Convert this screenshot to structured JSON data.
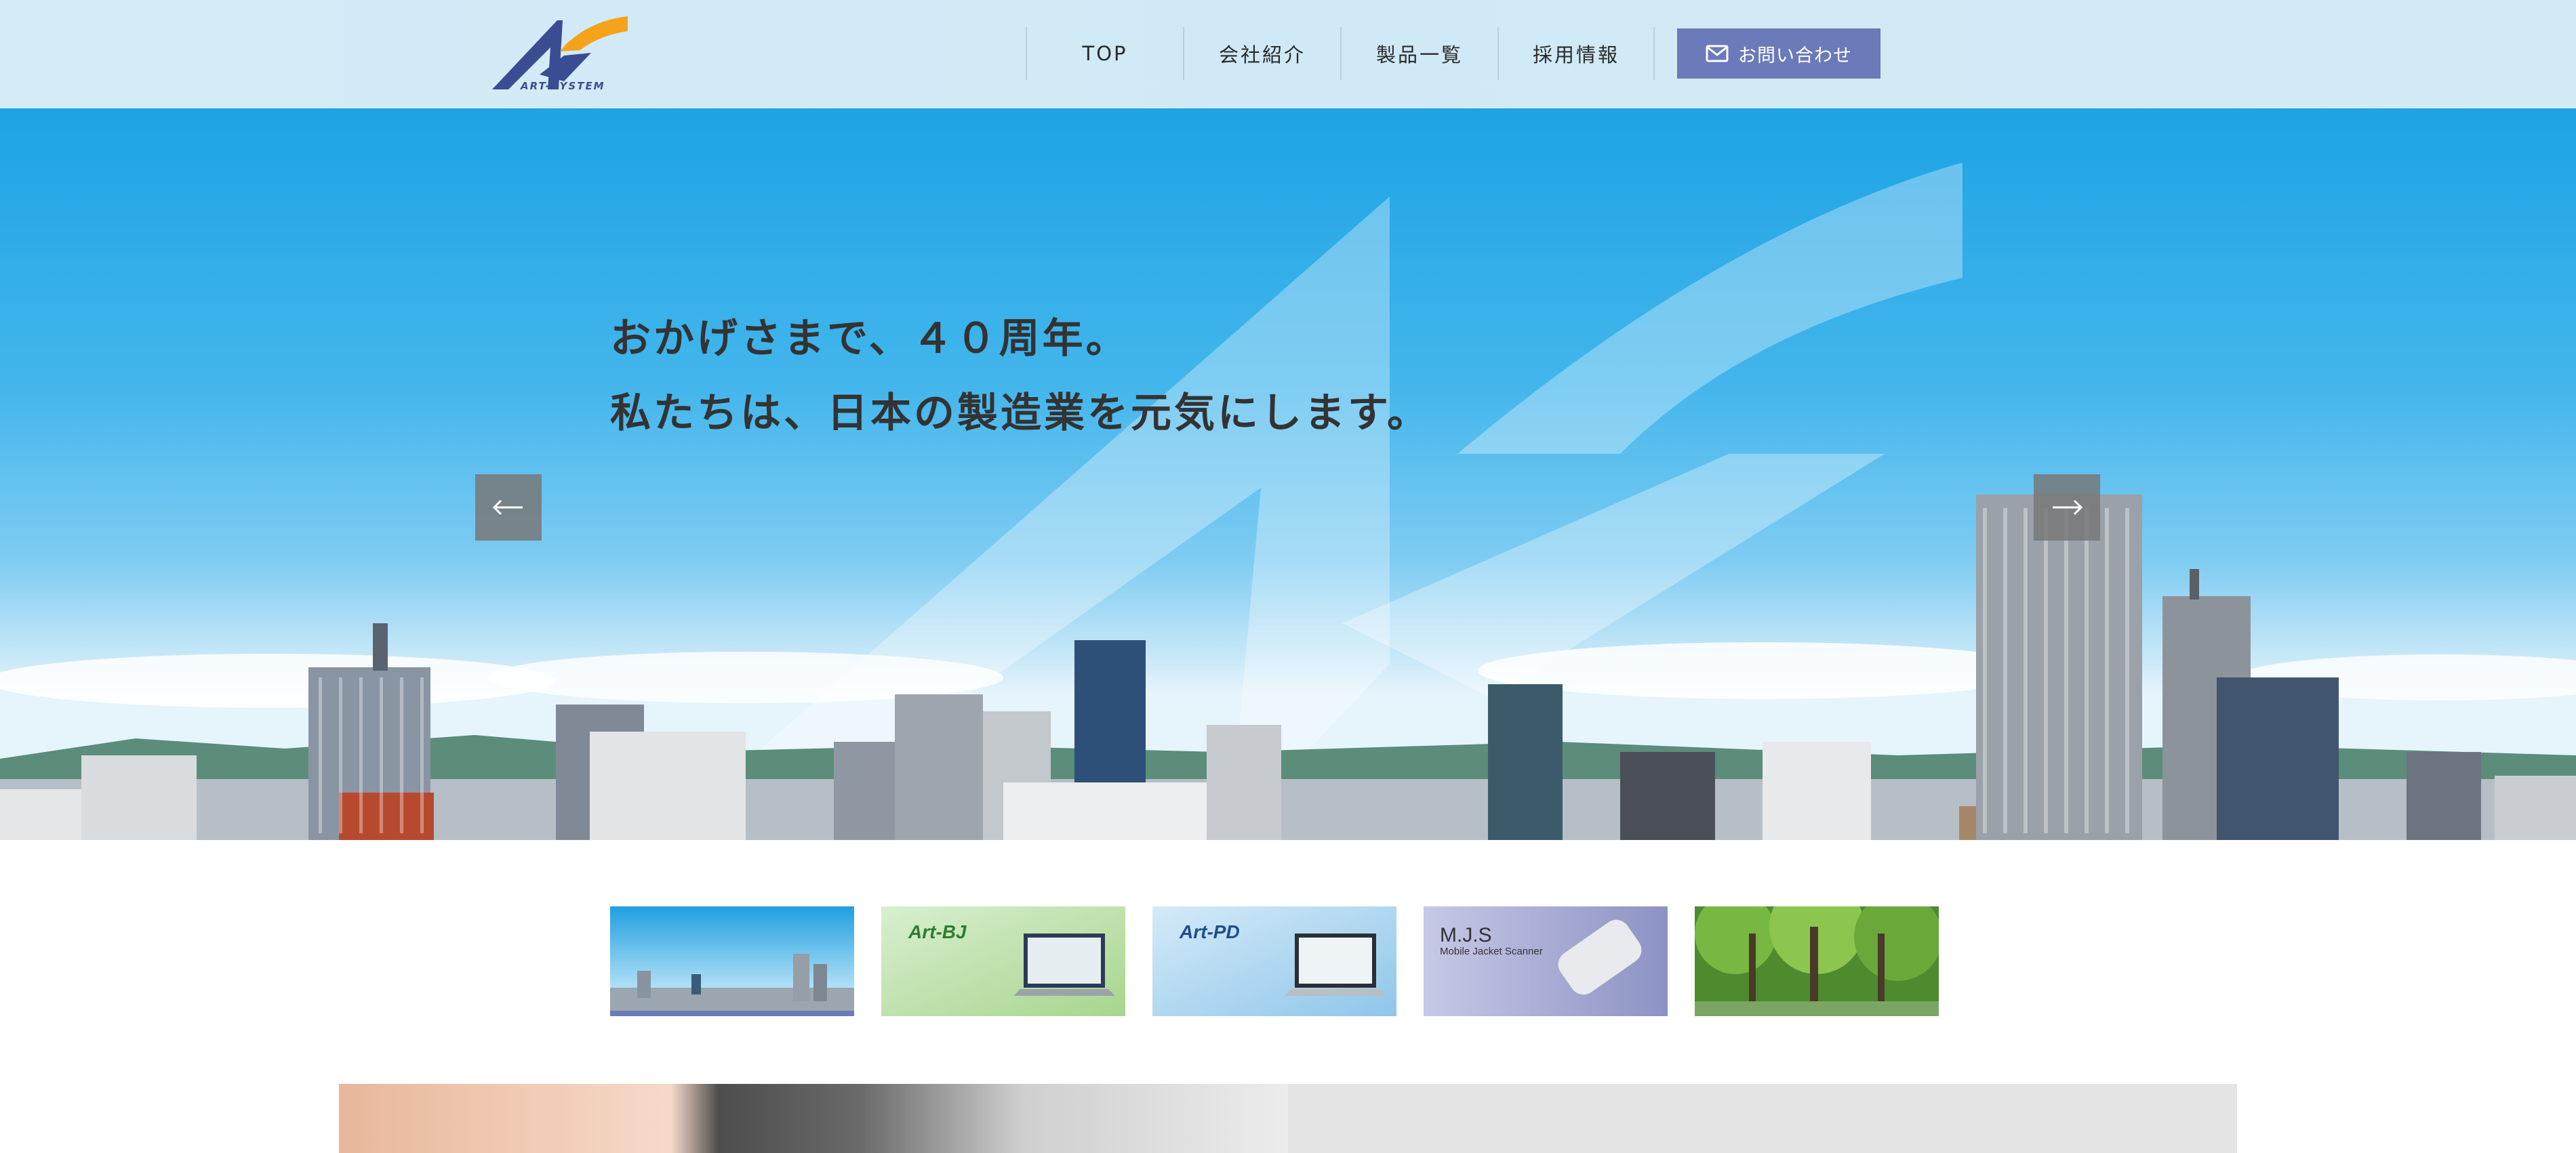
{
  "header": {
    "logo_text": "ART-SYSTEM",
    "nav": [
      {
        "label": "TOP"
      },
      {
        "label": "会社紹介"
      },
      {
        "label": "製品一覧"
      },
      {
        "label": "採用情報"
      }
    ],
    "contact_label": "お問い合わせ"
  },
  "hero": {
    "catch_line1": "おかげさまで、４０周年。",
    "catch_line2": "私たちは、日本の製造業を元気にします。",
    "prev_icon": "arrow-left-icon",
    "next_icon": "arrow-right-icon"
  },
  "thumbnails": [
    {
      "name": "city-skyline",
      "active": true
    },
    {
      "name": "art-bj",
      "title": "Art-BJ",
      "active": false
    },
    {
      "name": "art-pd",
      "title": "Art-PD",
      "active": false
    },
    {
      "name": "mjs",
      "title": "M.J.S",
      "subtitle": "Mobile Jacket Scanner",
      "active": false
    },
    {
      "name": "forest",
      "active": false
    }
  ],
  "colors": {
    "accent": "#6b7ab8",
    "header_bg": "#d3ebf7",
    "sky": "#1da3e4",
    "logo_orange": "#f5a31a",
    "logo_blue": "#3a4d92"
  }
}
